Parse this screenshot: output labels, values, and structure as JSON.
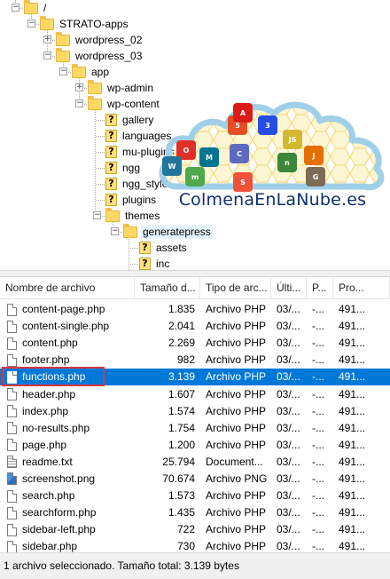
{
  "tree": {
    "nodes": [
      {
        "label": "/",
        "icon": "folder-icon",
        "expander": "-"
      },
      {
        "label": "STRATO-apps",
        "icon": "folder-icon",
        "expander": "-"
      },
      {
        "label": "wordpress_02",
        "icon": "folder-icon",
        "expander": "+"
      },
      {
        "label": "wordpress_03",
        "icon": "folder-icon",
        "expander": "-"
      },
      {
        "label": "app",
        "icon": "folder-icon",
        "expander": "-"
      },
      {
        "label": "wp-admin",
        "icon": "folder-icon",
        "expander": "+"
      },
      {
        "label": "wp-content",
        "icon": "folder-icon",
        "expander": "-"
      },
      {
        "label": "gallery",
        "icon": "unknown-folder-icon",
        "expander": ""
      },
      {
        "label": "languages",
        "icon": "unknown-folder-icon",
        "expander": ""
      },
      {
        "label": "mu-plugins",
        "icon": "unknown-folder-icon",
        "expander": ""
      },
      {
        "label": "ngg",
        "icon": "unknown-folder-icon",
        "expander": ""
      },
      {
        "label": "ngg_style",
        "icon": "unknown-folder-icon",
        "expander": ""
      },
      {
        "label": "plugins",
        "icon": "unknown-folder-icon",
        "expander": ""
      },
      {
        "label": "themes",
        "icon": "folder-icon",
        "expander": "-"
      },
      {
        "label": "generatepress",
        "icon": "folder-icon",
        "expander": "-"
      },
      {
        "label": "assets",
        "icon": "unknown-folder-icon",
        "expander": ""
      },
      {
        "label": "inc",
        "icon": "unknown-folder-icon",
        "expander": ""
      }
    ]
  },
  "watermark": {
    "text": "ColmenaEnLaNube.es",
    "icons": [
      "html5-icon",
      "angular-icon",
      "css3-icon",
      "oracle-icon",
      "c-icon",
      "nodejs-icon",
      "js-icon",
      "java-icon",
      "wordpress-icon",
      "mysql-icon",
      "mongodb-icon",
      "swift-icon",
      "gimp-icon"
    ]
  },
  "list": {
    "columns": [
      "Nombre de archivo",
      "Tamaño d...",
      "Tipo de arc...",
      "Últi...",
      "P...",
      "Pro..."
    ],
    "rows": [
      {
        "name": "content-page.php",
        "size": "1.835",
        "type": "Archivo PHP",
        "modified": "03/...",
        "perms": "-...",
        "owner": "491...",
        "icon": "php-file-icon"
      },
      {
        "name": "content-single.php",
        "size": "2.041",
        "type": "Archivo PHP",
        "modified": "03/...",
        "perms": "-...",
        "owner": "491...",
        "icon": "php-file-icon"
      },
      {
        "name": "content.php",
        "size": "2.269",
        "type": "Archivo PHP",
        "modified": "03/...",
        "perms": "-...",
        "owner": "491...",
        "icon": "php-file-icon"
      },
      {
        "name": "footer.php",
        "size": "982",
        "type": "Archivo PHP",
        "modified": "03/...",
        "perms": "-...",
        "owner": "491...",
        "icon": "php-file-icon"
      },
      {
        "name": "functions.php",
        "size": "3.139",
        "type": "Archivo PHP",
        "modified": "03/...",
        "perms": "-...",
        "owner": "491...",
        "icon": "php-file-icon"
      },
      {
        "name": "header.php",
        "size": "1.607",
        "type": "Archivo PHP",
        "modified": "03/...",
        "perms": "-...",
        "owner": "491...",
        "icon": "php-file-icon"
      },
      {
        "name": "index.php",
        "size": "1.574",
        "type": "Archivo PHP",
        "modified": "03/...",
        "perms": "-...",
        "owner": "491...",
        "icon": "php-file-icon"
      },
      {
        "name": "no-results.php",
        "size": "1.754",
        "type": "Archivo PHP",
        "modified": "03/...",
        "perms": "-...",
        "owner": "491...",
        "icon": "php-file-icon"
      },
      {
        "name": "page.php",
        "size": "1.200",
        "type": "Archivo PHP",
        "modified": "03/...",
        "perms": "-...",
        "owner": "491...",
        "icon": "php-file-icon"
      },
      {
        "name": "readme.txt",
        "size": "25.794",
        "type": "Document...",
        "modified": "03/...",
        "perms": "-...",
        "owner": "491...",
        "icon": "text-file-icon"
      },
      {
        "name": "screenshot.png",
        "size": "70.674",
        "type": "Archivo PNG",
        "modified": "03/...",
        "perms": "-...",
        "owner": "491...",
        "icon": "image-file-icon"
      },
      {
        "name": "search.php",
        "size": "1.573",
        "type": "Archivo PHP",
        "modified": "03/...",
        "perms": "-...",
        "owner": "491...",
        "icon": "php-file-icon"
      },
      {
        "name": "searchform.php",
        "size": "1.435",
        "type": "Archivo PHP",
        "modified": "03/...",
        "perms": "-...",
        "owner": "491...",
        "icon": "php-file-icon"
      },
      {
        "name": "sidebar-left.php",
        "size": "722",
        "type": "Archivo PHP",
        "modified": "03/...",
        "perms": "-...",
        "owner": "491...",
        "icon": "php-file-icon"
      },
      {
        "name": "sidebar.php",
        "size": "730",
        "type": "Archivo PHP",
        "modified": "03/...",
        "perms": "-...",
        "owner": "491...",
        "icon": "php-file-icon"
      }
    ],
    "selected_index": 4,
    "selection_color": "#0078d7",
    "highlight_outline_color": "#d9363e"
  },
  "status": {
    "text": "1 archivo seleccionado. Tamaño total: 3.139 bytes"
  }
}
